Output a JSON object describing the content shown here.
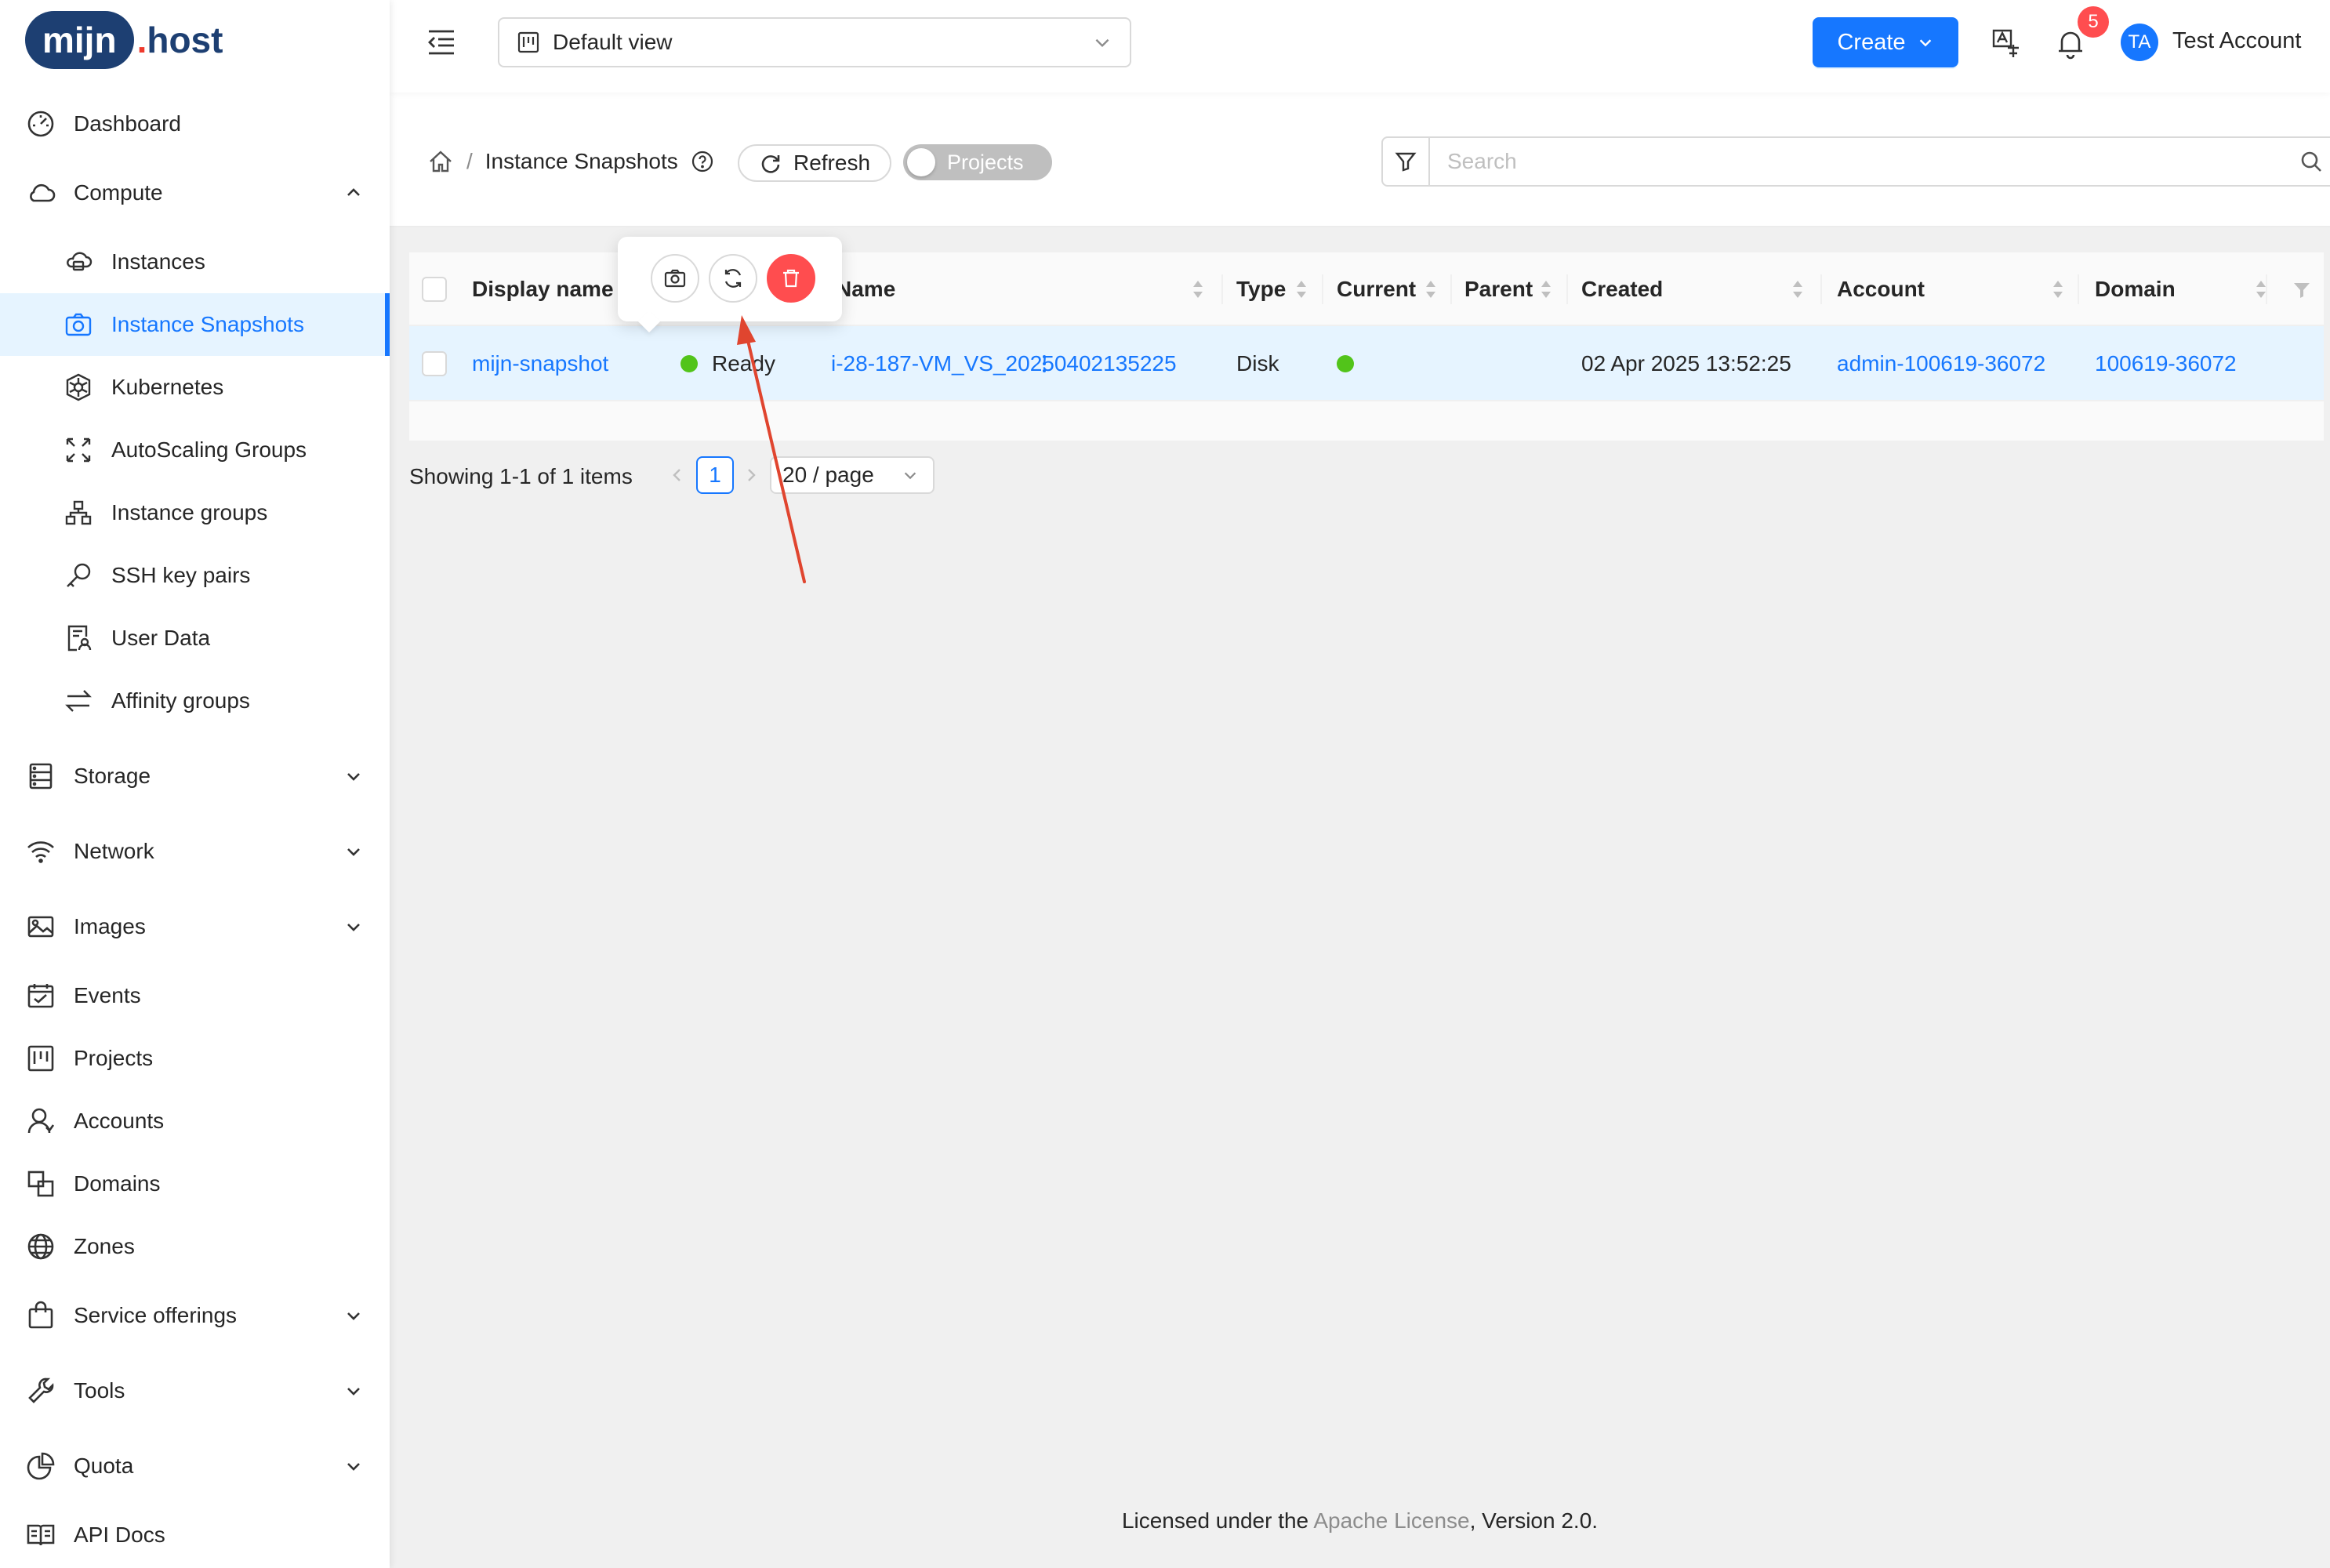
{
  "brand": {
    "badge": "mijn",
    "dot": ".",
    "rest": "host"
  },
  "sidebar": {
    "items": [
      {
        "label": "Dashboard"
      },
      {
        "label": "Compute"
      },
      {
        "label": "Instances"
      },
      {
        "label": "Instance Snapshots"
      },
      {
        "label": "Kubernetes"
      },
      {
        "label": "AutoScaling Groups"
      },
      {
        "label": "Instance groups"
      },
      {
        "label": "SSH key pairs"
      },
      {
        "label": "User Data"
      },
      {
        "label": "Affinity groups"
      },
      {
        "label": "Storage"
      },
      {
        "label": "Network"
      },
      {
        "label": "Images"
      },
      {
        "label": "Events"
      },
      {
        "label": "Projects"
      },
      {
        "label": "Accounts"
      },
      {
        "label": "Domains"
      },
      {
        "label": "Zones"
      },
      {
        "label": "Service offerings"
      },
      {
        "label": "Tools"
      },
      {
        "label": "Quota"
      },
      {
        "label": "API Docs"
      }
    ]
  },
  "header": {
    "view_select": "Default view",
    "create_label": "Create",
    "notification_count": "5",
    "avatar_initials": "TA",
    "account_name": "Test Account"
  },
  "page": {
    "breadcrumb_title": "Instance Snapshots",
    "breadcrumb_sep": "/",
    "refresh_label": "Refresh",
    "projects_toggle_label": "Projects",
    "search_placeholder": "Search"
  },
  "table": {
    "columns": [
      "Display name",
      "Name",
      "Type",
      "Current",
      "Parent",
      "Created",
      "Account",
      "Domain"
    ],
    "rows": [
      {
        "display_name": "mijn-snapshot",
        "state": "Ready",
        "name": "i-28-187-VM_VS_20250402135225",
        "type": "Disk",
        "current": true,
        "parent": "",
        "created": "02 Apr 2025 13:52:25",
        "account": "admin-100619-36072",
        "domain": "100619-36072"
      }
    ]
  },
  "row_actions": [
    "camera-icon",
    "revert-icon",
    "delete-icon"
  ],
  "pagination": {
    "total_text": "Showing 1-1 of 1 items",
    "current_page": "1",
    "page_size": "20 / page"
  },
  "footer": {
    "prefix": "Licensed under the ",
    "link": "Apache License",
    "suffix": ", Version 2.0."
  },
  "colors": {
    "primary": "#1677ff",
    "danger": "#ff4d4f",
    "success": "#52c41a",
    "brand": "#1d3f72",
    "annotation_arrow": "#e0452f"
  }
}
